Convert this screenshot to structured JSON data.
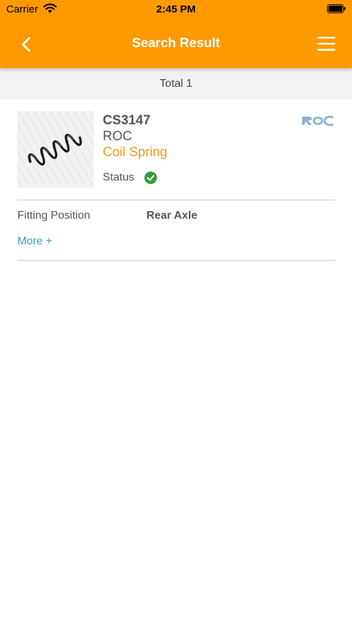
{
  "status_bar": {
    "carrier": "Carrier",
    "time": "2:45 PM"
  },
  "nav": {
    "title": "Search Result",
    "back_icon": "chevron-left-icon",
    "menu_icon": "hamburger-menu-icon"
  },
  "summary": {
    "total_text": "Total 1"
  },
  "result": {
    "part_number": "CS3147",
    "brand": "ROC",
    "category": "Coil Spring",
    "status_label": "Status",
    "status_icon": "check-circle-icon",
    "fitting_label": "Fitting Position",
    "fitting_value": "Rear Axle",
    "more_label": "More +"
  },
  "colors": {
    "header": "#FF9900",
    "category": "#F39A1E",
    "link": "#3A9DD0",
    "status_ok": "#2E9E3A",
    "total_bar": "#F2F2F2"
  }
}
